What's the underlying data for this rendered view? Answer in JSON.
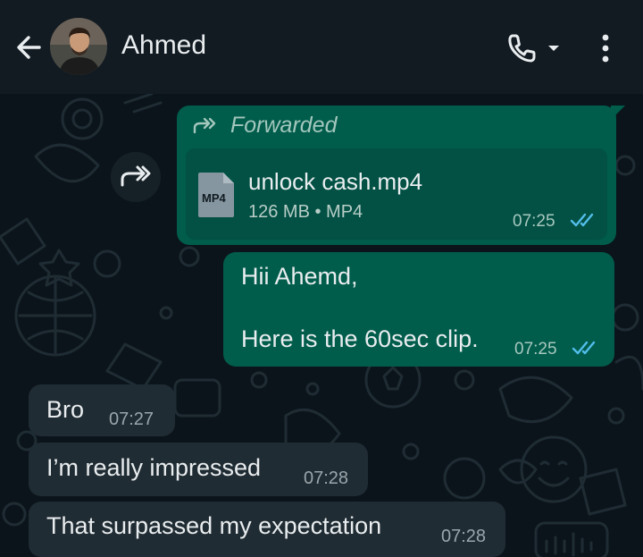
{
  "header": {
    "contact_name": "Ahmed",
    "back_icon": "arrow-left-icon",
    "call_icon": "phone-icon",
    "menu_icon": "more-vertical-icon"
  },
  "messages": {
    "forwarded": {
      "label": "Forwarded",
      "file_type": "MP4",
      "file_name": "unlock cash.mp4",
      "file_meta": "126 MB • MP4",
      "time": "07:25"
    },
    "outgoing_text": {
      "line1": "Hii Ahemd,",
      "line2": "Here is the 60sec clip.",
      "time": "07:25"
    },
    "incoming": [
      {
        "text": "Bro",
        "time": "07:27"
      },
      {
        "text": "I’m really impressed",
        "time": "07:28"
      },
      {
        "text": "That surpassed my expectation",
        "time": "07:28"
      }
    ]
  },
  "colors": {
    "outgoing_bubble": "#005c4b",
    "incoming_bubble": "#202c33",
    "read_ticks": "#53bdeb",
    "background": "#0b141a"
  }
}
